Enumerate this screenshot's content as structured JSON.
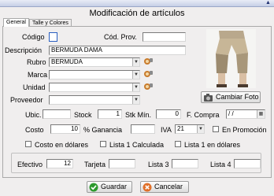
{
  "window": {
    "title": "Modificación de artículos"
  },
  "tabs": [
    {
      "label": "General"
    },
    {
      "label": "Talle y Colores"
    }
  ],
  "form": {
    "codigo": {
      "label": "Código",
      "value": ""
    },
    "cod_prov": {
      "label": "Cód. Prov.",
      "value": ""
    },
    "descripcion": {
      "label": "Descripción",
      "value": "BERMUDA DAMA"
    },
    "rubro": {
      "label": "Rubro",
      "value": "BERMUDA"
    },
    "marca": {
      "label": "Marca",
      "value": ""
    },
    "unidad": {
      "label": "Unidad",
      "value": ""
    },
    "proveedor": {
      "label": "Proveedor",
      "value": ""
    },
    "ubic": {
      "label": "Ubic.",
      "value": ""
    },
    "stock": {
      "label": "Stock",
      "value": "1"
    },
    "stk_min": {
      "label": "Stk Mín.",
      "value": "0"
    },
    "f_compra": {
      "label": "F. Compra",
      "value": "/ /"
    },
    "costo": {
      "label": "Costo",
      "value": "10"
    },
    "ganancia": {
      "label": "% Ganancia",
      "value": ""
    },
    "iva": {
      "label": "IVA",
      "value": "21"
    },
    "en_promocion": {
      "label": "En Promoción"
    },
    "costo_dolares": {
      "label": "Costo en dólares"
    },
    "lista1_calculada": {
      "label": "Lista 1 Calculada"
    },
    "lista1_dolares": {
      "label": "Lista 1 en dólares"
    },
    "efectivo": {
      "label": "Efectivo",
      "value": "12"
    },
    "tarjeta": {
      "label": "Tarjeta",
      "value": ""
    },
    "lista3": {
      "label": "Lista 3",
      "value": ""
    },
    "lista4": {
      "label": "Lista 4",
      "value": ""
    }
  },
  "buttons": {
    "cambiar_foto": "Cambiar Foto",
    "guardar": "Guardar",
    "cancelar": "Cancelar"
  },
  "colors": {
    "accent": "#d4d0c8",
    "guardar_icon": "#2e9a2e",
    "cancelar_icon": "#e0702a"
  }
}
